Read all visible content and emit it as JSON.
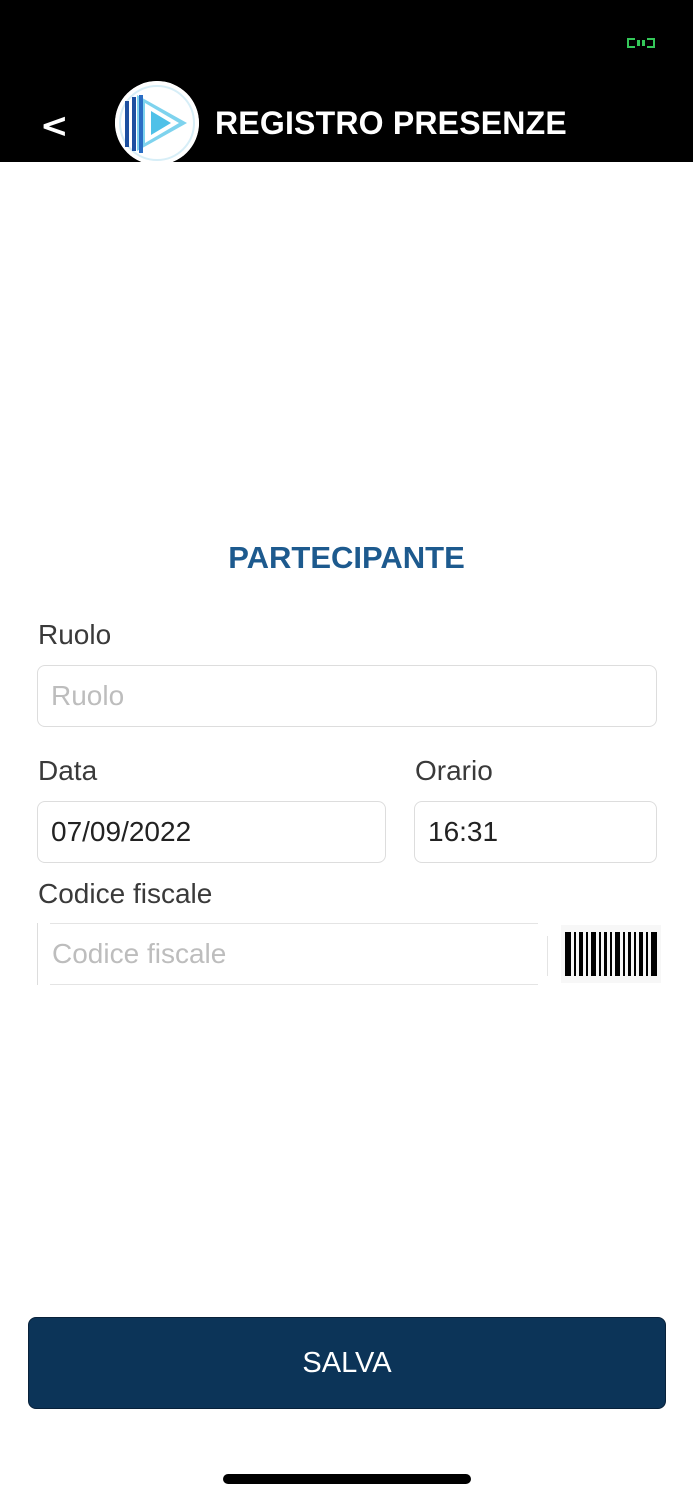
{
  "header": {
    "title": "REGISTRO PRESENZE",
    "back_label": "<",
    "logo_icon": "play-triangle-logo-icon",
    "status_color": "#34c759"
  },
  "form": {
    "section_title": "PARTECIPANTE",
    "ruolo": {
      "label": "Ruolo",
      "placeholder": "Ruolo",
      "value": ""
    },
    "data": {
      "label": "Data",
      "value": "07/09/2022"
    },
    "orario": {
      "label": "Orario",
      "value": "16:31"
    },
    "codice_fiscale": {
      "label": "Codice fiscale",
      "placeholder": "Codice fiscale",
      "value": "",
      "scan_icon": "barcode-icon"
    }
  },
  "actions": {
    "save_label": "SALVA"
  },
  "colors": {
    "header_bg": "#000000",
    "accent_title": "#1d5a8e",
    "primary_button": "#0c3458"
  }
}
